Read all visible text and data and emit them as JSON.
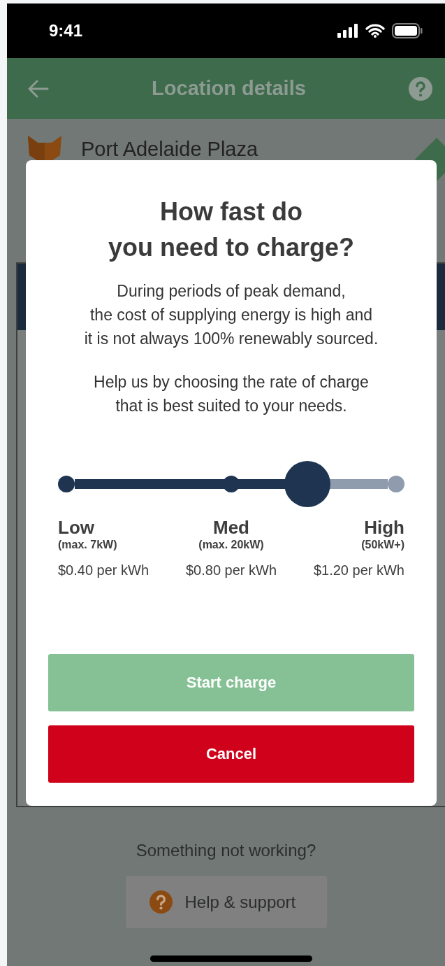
{
  "status_bar": {
    "time": "9:41"
  },
  "header": {
    "title": "Location details"
  },
  "location": {
    "name": "Port Adelaide Plaza"
  },
  "dialog": {
    "title_lines": [
      "How fast do",
      "you need to charge?"
    ],
    "paragraphs": [
      [
        "During periods of peak demand,",
        "the cost of supplying energy is high and",
        "it is not always 100% renewably sourced."
      ],
      [
        "Help us by choosing the rate of charge",
        "that is best suited to your needs."
      ]
    ],
    "rate_slider": {
      "level": 0.73,
      "stops": [
        {
          "label": "Low",
          "limit": "(max. 7kW)",
          "price": "$0.40 per kWh"
        },
        {
          "label": "Med",
          "limit": "(max. 20kW)",
          "price": "$0.80 per kWh"
        },
        {
          "label": "High",
          "limit": "(50kW+)",
          "price": "$1.20 per kWh"
        }
      ]
    },
    "buttons": [
      {
        "label": "Start charge",
        "kind": "primary",
        "disabled": true
      },
      {
        "label": "Cancel",
        "kind": "danger",
        "disabled": false
      }
    ]
  },
  "footer": {
    "prompt": "Something not working?",
    "help_button": "Help & support"
  }
}
